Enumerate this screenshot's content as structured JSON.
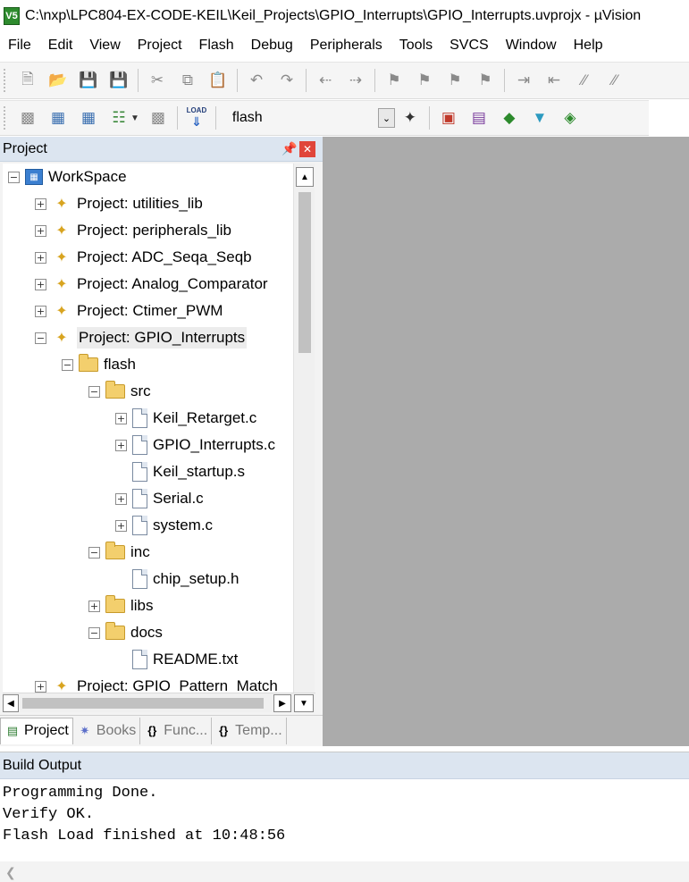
{
  "window": {
    "app_icon_text": "V5",
    "title": "C:\\nxp\\LPC804-EX-CODE-KEIL\\Keil_Projects\\GPIO_Interrupts\\GPIO_Interrupts.uvprojx - µVision"
  },
  "menu": [
    "File",
    "Edit",
    "View",
    "Project",
    "Flash",
    "Debug",
    "Peripherals",
    "Tools",
    "SVCS",
    "Window",
    "Help"
  ],
  "toolbar1": {
    "buttons": [
      "new-file-icon",
      "open-file-icon",
      "save-icon",
      "save-all-icon",
      "cut-icon",
      "copy-icon",
      "paste-icon",
      "undo-icon",
      "redo-icon",
      "nav-back-icon",
      "nav-forward-icon",
      "bookmark-insert-icon",
      "bookmark-prev-icon",
      "bookmark-next-icon",
      "bookmark-clear-icon",
      "indent-icon",
      "unindent-icon",
      "comment-icon",
      "uncomment-icon"
    ]
  },
  "toolbar2": {
    "load_icon_text": "LOAD",
    "target": "flash"
  },
  "project_panel": {
    "title": "Project",
    "tree": [
      {
        "label": "WorkSpace",
        "type": "workspace",
        "level": 0,
        "expander": "minus"
      },
      {
        "label": "Project: utilities_lib",
        "type": "project",
        "level": 1,
        "expander": "plus"
      },
      {
        "label": "Project: peripherals_lib",
        "type": "project",
        "level": 1,
        "expander": "plus"
      },
      {
        "label": "Project: ADC_Seqa_Seqb",
        "type": "project",
        "level": 1,
        "expander": "plus"
      },
      {
        "label": "Project: Analog_Comparator",
        "type": "project",
        "level": 1,
        "expander": "plus"
      },
      {
        "label": "Project: Ctimer_PWM",
        "type": "project",
        "level": 1,
        "expander": "plus"
      },
      {
        "label": "Project: GPIO_Interrupts",
        "type": "project",
        "level": 1,
        "expander": "minus",
        "selected": true
      },
      {
        "label": "flash",
        "type": "target",
        "level": 2,
        "expander": "minus"
      },
      {
        "label": "src",
        "type": "folder",
        "level": 3,
        "expander": "minus"
      },
      {
        "label": "Keil_Retarget.c",
        "type": "file",
        "level": 4,
        "expander": "plus"
      },
      {
        "label": "GPIO_Interrupts.c",
        "type": "file",
        "level": 4,
        "expander": "plus"
      },
      {
        "label": "Keil_startup.s",
        "type": "file",
        "level": 4,
        "expander": "none"
      },
      {
        "label": "Serial.c",
        "type": "file",
        "level": 4,
        "expander": "plus"
      },
      {
        "label": "system.c",
        "type": "file",
        "level": 4,
        "expander": "plus"
      },
      {
        "label": "inc",
        "type": "folder",
        "level": 3,
        "expander": "minus"
      },
      {
        "label": "chip_setup.h",
        "type": "file",
        "level": 4,
        "expander": "none"
      },
      {
        "label": "libs",
        "type": "folder",
        "level": 3,
        "expander": "plus"
      },
      {
        "label": "docs",
        "type": "folder",
        "level": 3,
        "expander": "minus"
      },
      {
        "label": "README.txt",
        "type": "file",
        "level": 4,
        "expander": "none"
      },
      {
        "label": "Project: GPIO_Pattern_Match",
        "type": "project",
        "level": 1,
        "expander": "plus"
      }
    ],
    "tabs": [
      {
        "label": "Project",
        "icon": "project-tab-icon",
        "active": true
      },
      {
        "label": "Books",
        "icon": "books-icon",
        "active": false
      },
      {
        "label": "Func...",
        "icon": "functions-icon",
        "active": false
      },
      {
        "label": "Temp...",
        "icon": "templates-icon",
        "active": false
      }
    ]
  },
  "build_output": {
    "title": "Build Output",
    "lines": [
      "Programming Done.",
      "Verify OK.",
      "Flash Load finished at 10:48:56"
    ]
  },
  "colors": {
    "annotation_arrow": "#e8141c",
    "panel_header": "#dce5f0",
    "editor_background": "#ababab"
  }
}
